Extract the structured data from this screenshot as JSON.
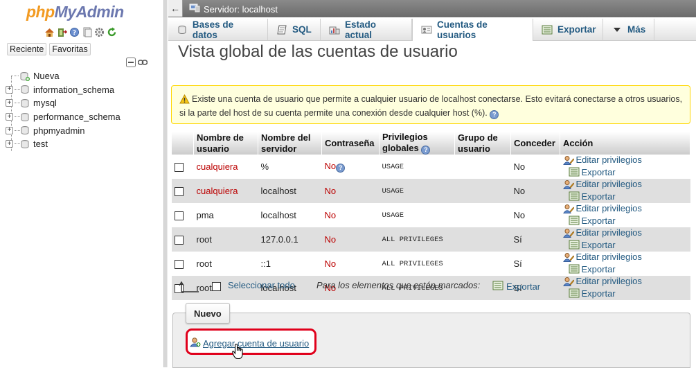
{
  "nav": {
    "logo_php": "php",
    "logo_myadmin": "MyAdmin",
    "tabs": [
      "Reciente",
      "Favoritas"
    ],
    "icons": [
      "home-icon",
      "exit-icon",
      "help-icon",
      "docs-icon",
      "settings-icon",
      "reload-icon"
    ],
    "databases": [
      {
        "name": "Nueva",
        "kind": "new"
      },
      {
        "name": "information_schema",
        "kind": "db"
      },
      {
        "name": "mysql",
        "kind": "db"
      },
      {
        "name": "performance_schema",
        "kind": "db"
      },
      {
        "name": "phpmyadmin",
        "kind": "db"
      },
      {
        "name": "test",
        "kind": "db"
      }
    ]
  },
  "breadcrumb": {
    "server": "Servidor: localhost"
  },
  "menu": {
    "tabs": [
      {
        "label": "Bases de datos",
        "icon": "database-icon"
      },
      {
        "label": "SQL",
        "icon": "sql-icon"
      },
      {
        "label": "Estado actual",
        "icon": "status-icon"
      },
      {
        "label": "Cuentas de usuarios",
        "icon": "users-icon",
        "active": true
      },
      {
        "label": "Exportar",
        "icon": "export-icon"
      },
      {
        "label": "Más",
        "icon": "caret-down-icon"
      }
    ]
  },
  "page": {
    "title": "Vista global de las cuentas de usuario"
  },
  "notice": {
    "text": "Existe una cuenta de usuario que permite a cualquier usuario de localhost conectarse. Esto evitará conectarse a otros usuarios, si la parte del host de su cuenta permite una conexión desde cualquier host (%)."
  },
  "table": {
    "headers": {
      "user": "Nombre de usuario",
      "host": "Nombre del servidor",
      "password": "Contraseña",
      "privileges": "Privilegios globales",
      "group": "Grupo de usuario",
      "grant": "Conceder",
      "action": "Acción"
    },
    "edit_label": "Editar privilegios",
    "export_label": "Exportar",
    "rows": [
      {
        "user": "cualquiera",
        "host": "%",
        "password": "No",
        "privileges": "USAGE",
        "grant": "No",
        "user_red": true
      },
      {
        "user": "cualquiera",
        "host": "localhost",
        "password": "No",
        "privileges": "USAGE",
        "grant": "No",
        "user_red": true
      },
      {
        "user": "pma",
        "host": "localhost",
        "password": "No",
        "privileges": "USAGE",
        "grant": "No",
        "user_red": false
      },
      {
        "user": "root",
        "host": "127.0.0.1",
        "password": "No",
        "privileges": "ALL PRIVILEGES",
        "grant": "Sí",
        "user_red": false
      },
      {
        "user": "root",
        "host": "::1",
        "password": "No",
        "privileges": "ALL PRIVILEGES",
        "grant": "Sí",
        "user_red": false
      },
      {
        "user": "root",
        "host": "localhost",
        "password": "No",
        "privileges": "ALL PRIVILEGES",
        "grant": "Sí",
        "user_red": false
      }
    ]
  },
  "bulk": {
    "select_all": "Seleccionar todo",
    "marked": "Para los elementos que están marcados:",
    "export": "Exportar"
  },
  "new_section": {
    "legend": "Nuevo",
    "add_user": "Agregar cuenta de usuario"
  },
  "colors": {
    "link": "#235a81",
    "highlight": "#e0001b",
    "danger_text": "#bb0000"
  }
}
